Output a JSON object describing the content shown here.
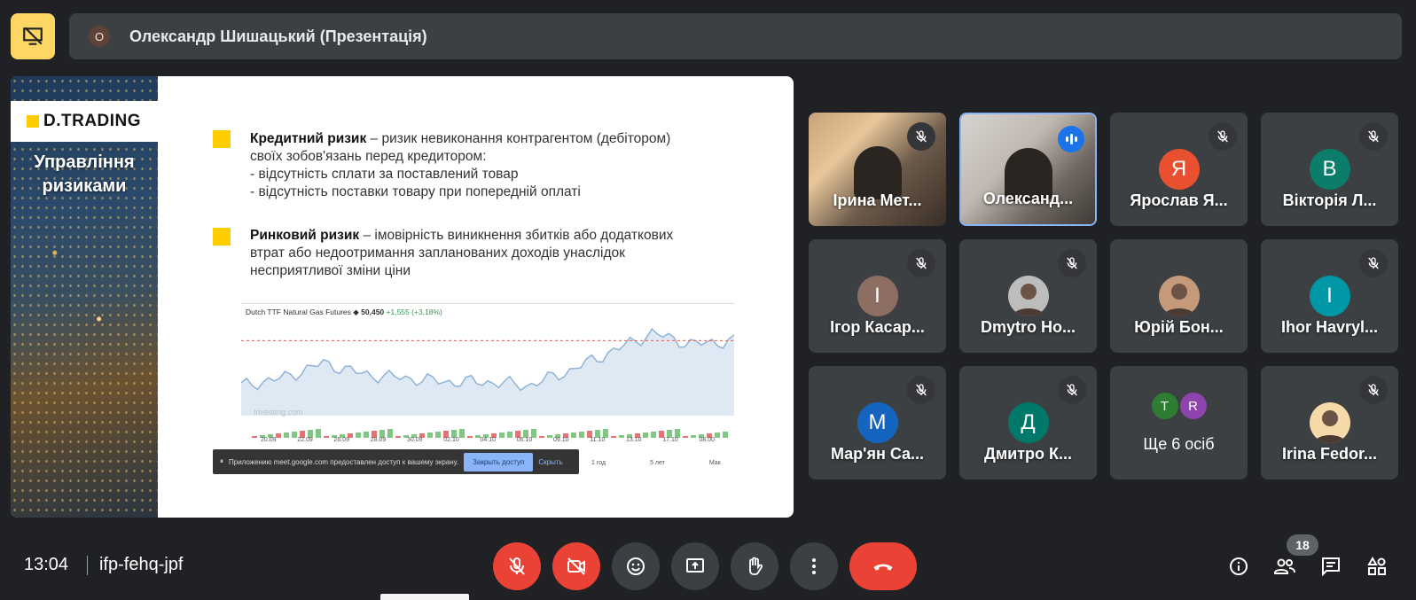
{
  "presenter_banner": {
    "avatar_letter": "О",
    "title": "Олександр Шишацький (Презентація)"
  },
  "slide": {
    "brand": "D.TRADING",
    "heading": "Управління ризиками",
    "credit_risk_term": "Кредитний ризик",
    "credit_risk_def": " – ризик невиконання контрагентом (дебітором) своїх зобов'язань перед кредитором:",
    "credit_risk_item1": "- відсутність сплати за поставлений товар",
    "credit_risk_item2": "- відсутність поставки товару при попередній оплаті",
    "market_risk_term": "Ринковий ризик",
    "market_risk_def": " – імовірність виникнення збитків або додаткових втрат або недоотримання запланованих доходів унаслідок несприятливої зміни ціни",
    "chart_title": "Dutch TTF Natural Gas Futures",
    "chart_price": "50,450",
    "chart_change": "+1,555",
    "chart_change_pct": "(+3,18%)",
    "chart_watermark": "Investing",
    "chart_watermark_suffix": ".com",
    "chart_xlabels": [
      "20.09",
      "22.09",
      "26.09",
      "28.09",
      "30.09",
      "02.10",
      "04.10",
      "06.10",
      "09.10",
      "11.10",
      "13.10",
      "17.10",
      "08.00"
    ],
    "chart_ranges": [
      "1 год",
      "5 лет",
      "Мак"
    ],
    "share_notice": "Приложению meet.google.com предоставлен доступ к вашему экрану.",
    "share_stop": "Закрыть доступ",
    "share_hide": "Скрыть"
  },
  "chart_data": {
    "type": "area",
    "title": "Dutch TTF Natural Gas Futures",
    "x": [
      "20.09",
      "22.09",
      "26.09",
      "28.09",
      "30.09",
      "02.10",
      "04.10",
      "06.10",
      "09.10",
      "11.10",
      "13.10",
      "17.10",
      "08.00"
    ],
    "series": [
      {
        "values": [
          38,
          40,
          44,
          41,
          40,
          39,
          39,
          38,
          42,
          47,
          52,
          49,
          50
        ]
      }
    ]
  },
  "participants": [
    {
      "name": "Ірина Мет...",
      "type": "video",
      "muted": true
    },
    {
      "name": "Олександ...",
      "type": "video",
      "speaking": true
    },
    {
      "name": "Ярослав Я...",
      "letter": "Я",
      "color": "#e8502f",
      "muted": true
    },
    {
      "name": "Вікторія Л...",
      "letter": "В",
      "color": "#0b7d6a",
      "muted": true
    },
    {
      "name": "Ігор Касар...",
      "letter": "І",
      "color": "#8d6e63",
      "muted": true
    },
    {
      "name": "Dmytro Ho...",
      "type": "photo",
      "muted": true
    },
    {
      "name": "Юрій Бон...",
      "type": "photo"
    },
    {
      "name": "Ihor Havryl...",
      "letter": "I",
      "color": "#0097a7",
      "muted": true
    },
    {
      "name": "Мар'ян Са...",
      "letter": "М",
      "color": "#1565c0",
      "muted": true
    },
    {
      "name": "Дмитро К...",
      "letter": "Д",
      "color": "#00796b",
      "muted": true
    },
    {
      "name": "Ще 6 осіб",
      "type": "more"
    },
    {
      "name": "Irina Fedor...",
      "type": "photo",
      "muted": true
    }
  ],
  "more_avatars": [
    {
      "letter": "T",
      "color": "#2e7d32"
    },
    {
      "letter": "R",
      "color": "#8e44ad"
    }
  ],
  "bottom_bar": {
    "time": "13:04",
    "meeting_code": "ifp-fehq-jpf",
    "participant_count": "18"
  },
  "colors": {
    "background": "#202124",
    "tile": "#3c4043",
    "danger": "#ea4335",
    "accent_blue": "#8ab4f8",
    "presenting_yellow": "#fdd663"
  }
}
